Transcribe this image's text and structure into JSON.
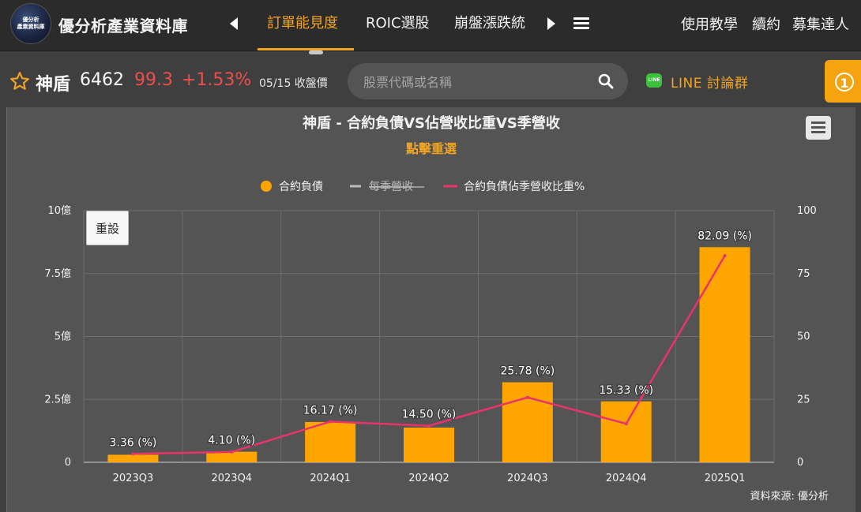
{
  "brand": {
    "logo_line1": "優分析",
    "logo_line2": "產業資料庫",
    "name": "優分析產業資料庫"
  },
  "nav": {
    "tabs": [
      {
        "label": "訂單能見度",
        "active": true
      },
      {
        "label": "ROIC選股",
        "active": false
      },
      {
        "label": "崩盤漲跌統",
        "active": false
      }
    ],
    "right_links": [
      "使用教學",
      "續約",
      "募集達人"
    ],
    "accent_color": "#f0a421"
  },
  "stock": {
    "name": "神盾",
    "code": "6462",
    "price": "99.3",
    "change": "+1.53%",
    "date_label": "05/15 收盤價",
    "up_color": "#ef4d4d"
  },
  "search": {
    "placeholder": "股票代碼或名稱"
  },
  "line_group": {
    "icon_text": "LINE",
    "label": "LINE 討論群"
  },
  "notification": {
    "count": "1"
  },
  "chart_ui": {
    "reset_label": "重設",
    "click_hint": "點擊重選",
    "source": "資料來源: 優分析"
  },
  "chart_data": {
    "type": "bar",
    "title": "神盾 - 合約負債VS佔營收比重VS季營收",
    "categories": [
      "2023Q3",
      "2023Q4",
      "2024Q1",
      "2024Q2",
      "2024Q3",
      "2024Q4",
      "2025Q1"
    ],
    "series": [
      {
        "name": "合約負債",
        "type": "bar",
        "axis": "left",
        "color": "#ffa500",
        "values": [
          0.3,
          0.42,
          1.6,
          1.38,
          3.18,
          2.42,
          8.55
        ]
      },
      {
        "name": "每季營收",
        "type": "line",
        "axis": "left",
        "hidden": true,
        "color": "#bbbbbb",
        "values": []
      },
      {
        "name": "合約負債佔季營收比重%",
        "type": "line",
        "axis": "right",
        "color": "#e8336b",
        "values": [
          3.36,
          4.1,
          16.17,
          14.5,
          25.78,
          15.33,
          82.09
        ],
        "labels": [
          "3.36 (%)",
          "4.10 (%)",
          "16.17 (%)",
          "14.50 (%)",
          "25.78 (%)",
          "15.33 (%)",
          "82.09 (%)"
        ]
      }
    ],
    "y_left": {
      "min": 0,
      "max": 10,
      "ticks": [
        0,
        2.5,
        5,
        7.5,
        10
      ],
      "tick_labels": [
        "0",
        "2.5億",
        "5億",
        "7.5億",
        "10億"
      ]
    },
    "y_right": {
      "min": 0,
      "max": 100,
      "ticks": [
        0,
        25,
        50,
        75,
        100
      ],
      "tick_labels": [
        "0",
        "25",
        "50",
        "75",
        "100"
      ]
    },
    "grid": true,
    "legend_position": "top-center"
  }
}
